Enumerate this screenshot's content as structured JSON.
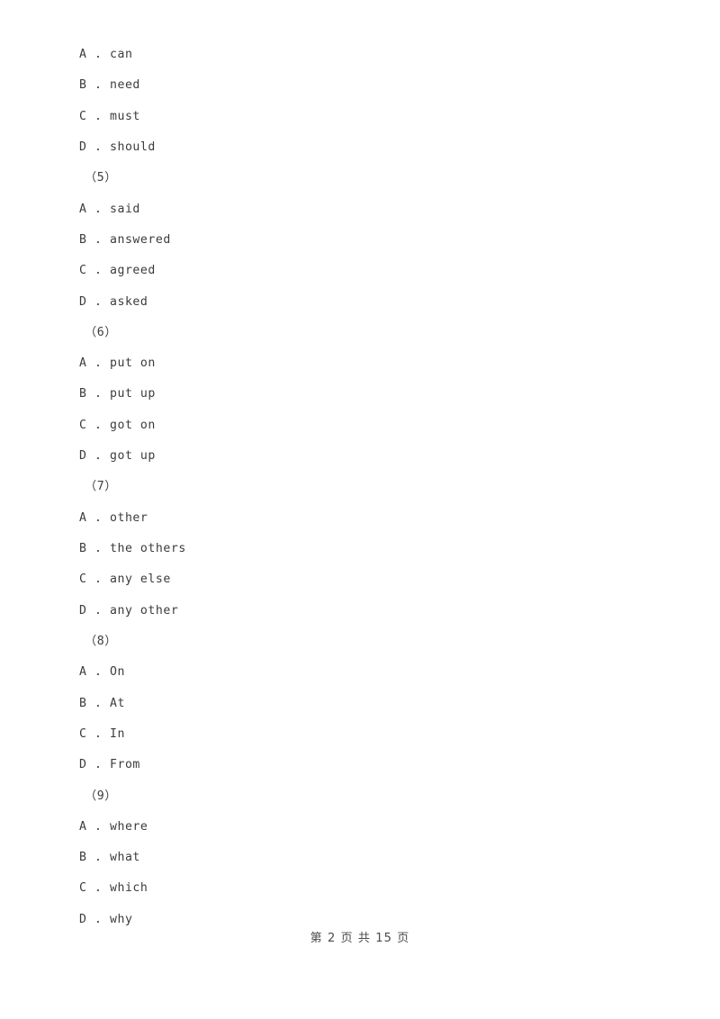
{
  "document": {
    "blocks": [
      {
        "kind": "options",
        "items": [
          {
            "letter": "A",
            "separator": " . ",
            "text": "can"
          },
          {
            "letter": "B",
            "separator": " . ",
            "text": "need"
          },
          {
            "letter": "C",
            "separator": " . ",
            "text": "must"
          },
          {
            "letter": "D",
            "separator": " . ",
            "text": "should"
          }
        ]
      },
      {
        "kind": "question-number",
        "label": "（5）"
      },
      {
        "kind": "options",
        "items": [
          {
            "letter": "A",
            "separator": " . ",
            "text": "said"
          },
          {
            "letter": "B",
            "separator": " . ",
            "text": "answered"
          },
          {
            "letter": "C",
            "separator": " . ",
            "text": "agreed"
          },
          {
            "letter": "D",
            "separator": " . ",
            "text": "asked"
          }
        ]
      },
      {
        "kind": "question-number",
        "label": "（6）"
      },
      {
        "kind": "options",
        "items": [
          {
            "letter": "A",
            "separator": " . ",
            "text": "put on"
          },
          {
            "letter": "B",
            "separator": " . ",
            "text": "put up"
          },
          {
            "letter": "C",
            "separator": " . ",
            "text": "got on"
          },
          {
            "letter": "D",
            "separator": " . ",
            "text": "got up"
          }
        ]
      },
      {
        "kind": "question-number",
        "label": "（7）"
      },
      {
        "kind": "options",
        "items": [
          {
            "letter": "A",
            "separator": " . ",
            "text": "other"
          },
          {
            "letter": "B",
            "separator": " . ",
            "text": "the others"
          },
          {
            "letter": "C",
            "separator": " . ",
            "text": "any else"
          },
          {
            "letter": "D",
            "separator": " . ",
            "text": "any other"
          }
        ]
      },
      {
        "kind": "question-number",
        "label": "（8）"
      },
      {
        "kind": "options",
        "items": [
          {
            "letter": "A",
            "separator": " . ",
            "text": "On"
          },
          {
            "letter": "B",
            "separator": " . ",
            "text": "At"
          },
          {
            "letter": "C",
            "separator": " . ",
            "text": "In"
          },
          {
            "letter": "D",
            "separator": " . ",
            "text": "From"
          }
        ]
      },
      {
        "kind": "question-number",
        "label": "（9）"
      },
      {
        "kind": "options",
        "items": [
          {
            "letter": "A",
            "separator": " . ",
            "text": "where"
          },
          {
            "letter": "B",
            "separator": " . ",
            "text": "what"
          },
          {
            "letter": "C",
            "separator": " . ",
            "text": "which"
          },
          {
            "letter": "D",
            "separator": " . ",
            "text": "why"
          }
        ]
      }
    ],
    "footer": {
      "text": "第 2 页 共 15 页",
      "page_number": "2",
      "total_pages": "15"
    }
  }
}
